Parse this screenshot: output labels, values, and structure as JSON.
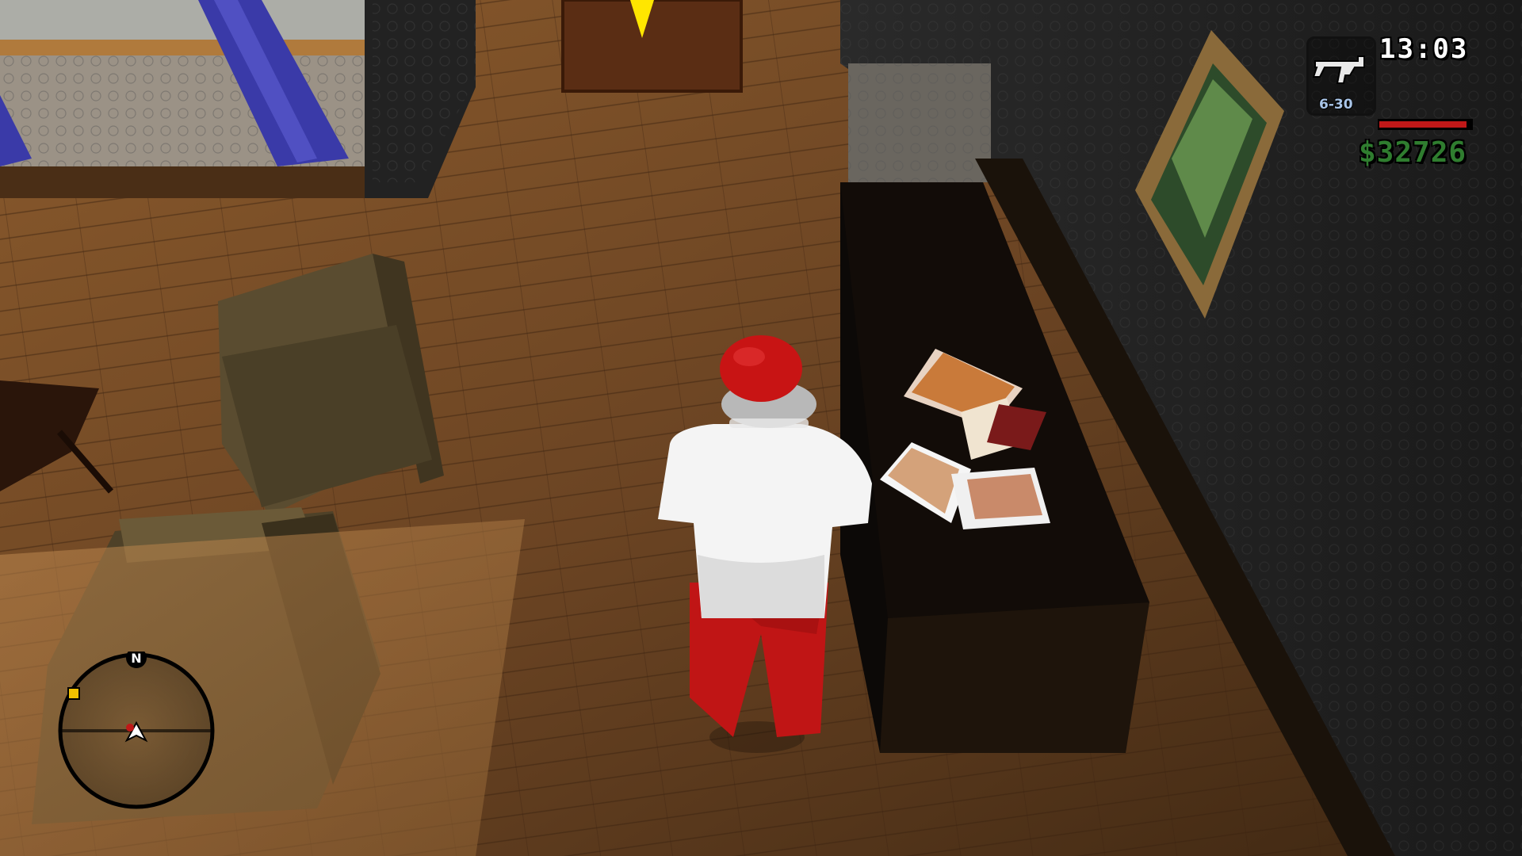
{
  "hud": {
    "clock": "13:03",
    "money": "$32726",
    "ammo": "6-30",
    "weapon_icon": "smg-icon",
    "health_fraction": 0.95,
    "radar": {
      "north_label": "N",
      "north_icon": "north-marker-icon",
      "player_icon": "player-arrow-icon",
      "waypoint_icon": "yellow-square-blip-icon"
    }
  },
  "colors": {
    "money": "#2f7d2f",
    "health": "#c01818",
    "ammo": "#a9c5e8",
    "clock": "#ffffff"
  }
}
